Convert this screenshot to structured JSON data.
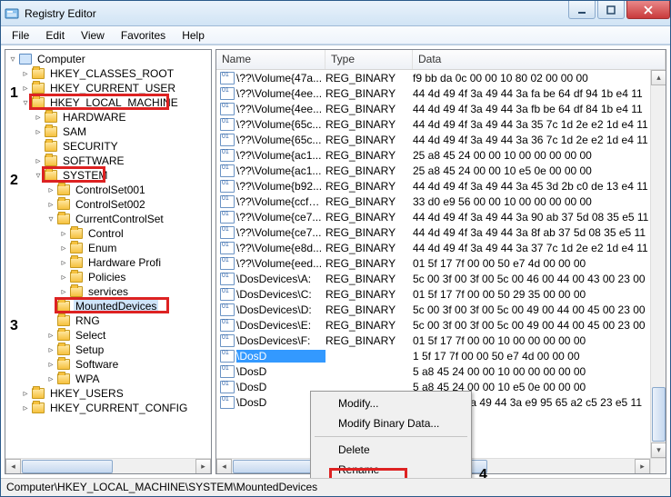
{
  "window": {
    "title": "Registry Editor"
  },
  "menu": {
    "file": "File",
    "edit": "Edit",
    "view": "View",
    "favorites": "Favorites",
    "help": "Help"
  },
  "tree": [
    {
      "lvl": 0,
      "toggle": "▿",
      "icon": "computer",
      "label": "Computer"
    },
    {
      "lvl": 1,
      "toggle": "▹",
      "icon": "folder",
      "label": "HKEY_CLASSES_ROOT"
    },
    {
      "lvl": 1,
      "toggle": "▹",
      "icon": "folder",
      "label": "HKEY_CURRENT_USER"
    },
    {
      "lvl": 1,
      "toggle": "▿",
      "icon": "folder",
      "label": "HKEY_LOCAL_MACHINE",
      "red": true
    },
    {
      "lvl": 2,
      "toggle": "▹",
      "icon": "folder",
      "label": "HARDWARE"
    },
    {
      "lvl": 2,
      "toggle": "▹",
      "icon": "folder",
      "label": "SAM"
    },
    {
      "lvl": 2,
      "toggle": "",
      "icon": "folder",
      "label": "SECURITY"
    },
    {
      "lvl": 2,
      "toggle": "▹",
      "icon": "folder",
      "label": "SOFTWARE"
    },
    {
      "lvl": 2,
      "toggle": "▿",
      "icon": "folder",
      "label": "SYSTEM",
      "red": true
    },
    {
      "lvl": 3,
      "toggle": "▹",
      "icon": "folder",
      "label": "ControlSet001"
    },
    {
      "lvl": 3,
      "toggle": "▹",
      "icon": "folder",
      "label": "ControlSet002"
    },
    {
      "lvl": 3,
      "toggle": "▿",
      "icon": "folder",
      "label": "CurrentControlSet"
    },
    {
      "lvl": 4,
      "toggle": "▹",
      "icon": "folder",
      "label": "Control"
    },
    {
      "lvl": 4,
      "toggle": "▹",
      "icon": "folder",
      "label": "Enum"
    },
    {
      "lvl": 4,
      "toggle": "▹",
      "icon": "folder",
      "label": "Hardware Profi"
    },
    {
      "lvl": 4,
      "toggle": "▹",
      "icon": "folder",
      "label": "Policies"
    },
    {
      "lvl": 4,
      "toggle": "▹",
      "icon": "folder",
      "label": "services"
    },
    {
      "lvl": 3,
      "toggle": "",
      "icon": "folder",
      "label": "MountedDevices",
      "red": true,
      "sel": true
    },
    {
      "lvl": 3,
      "toggle": "",
      "icon": "folder",
      "label": "RNG"
    },
    {
      "lvl": 3,
      "toggle": "▹",
      "icon": "folder",
      "label": "Select"
    },
    {
      "lvl": 3,
      "toggle": "▹",
      "icon": "folder",
      "label": "Setup"
    },
    {
      "lvl": 3,
      "toggle": "▹",
      "icon": "folder",
      "label": "Software"
    },
    {
      "lvl": 3,
      "toggle": "▹",
      "icon": "folder",
      "label": "WPA"
    },
    {
      "lvl": 1,
      "toggle": "▹",
      "icon": "folder",
      "label": "HKEY_USERS"
    },
    {
      "lvl": 1,
      "toggle": "▹",
      "icon": "folder",
      "label": "HKEY_CURRENT_CONFIG"
    }
  ],
  "list": {
    "cols": {
      "name": "Name",
      "type": "Type",
      "data": "Data"
    },
    "rows": [
      {
        "name": "\\??\\Volume{47a...",
        "type": "REG_BINARY",
        "data": "f9 bb da 0c 00 00 10 80 02 00 00 00"
      },
      {
        "name": "\\??\\Volume{4ee...",
        "type": "REG_BINARY",
        "data": "44 4d 49 4f 3a 49 44 3a fa be 64 df 94 1b e4 11"
      },
      {
        "name": "\\??\\Volume{4ee...",
        "type": "REG_BINARY",
        "data": "44 4d 49 4f 3a 49 44 3a fb be 64 df 84 1b e4 11"
      },
      {
        "name": "\\??\\Volume{65c...",
        "type": "REG_BINARY",
        "data": "44 4d 49 4f 3a 49 44 3a 35 7c 1d 2e e2 1d e4 11"
      },
      {
        "name": "\\??\\Volume{65c...",
        "type": "REG_BINARY",
        "data": "44 4d 49 4f 3a 49 44 3a 36 7c 1d 2e e2 1d e4 11"
      },
      {
        "name": "\\??\\Volume{ac1...",
        "type": "REG_BINARY",
        "data": "25 a8 45 24 00 00 10 00 00 00 00 00"
      },
      {
        "name": "\\??\\Volume{ac1...",
        "type": "REG_BINARY",
        "data": "25 a8 45 24 00 00 10 e5 0e 00 00 00"
      },
      {
        "name": "\\??\\Volume{b92...",
        "type": "REG_BINARY",
        "data": "44 4d 49 4f 3a 49 44 3a 45 3d 2b c0 de 13 e4 11"
      },
      {
        "name": "\\??\\Volume{ccf1...",
        "type": "REG_BINARY",
        "data": "33 d0 e9 56 00 00 10 00 00 00 00 00"
      },
      {
        "name": "\\??\\Volume{ce7...",
        "type": "REG_BINARY",
        "data": "44 4d 49 4f 3a 49 44 3a 90 ab 37 5d 08 35 e5 11"
      },
      {
        "name": "\\??\\Volume{ce7...",
        "type": "REG_BINARY",
        "data": "44 4d 49 4f 3a 49 44 3a 8f ab 37 5d 08 35 e5 11"
      },
      {
        "name": "\\??\\Volume{e8d...",
        "type": "REG_BINARY",
        "data": "44 4d 49 4f 3a 49 44 3a 37 7c 1d 2e e2 1d e4 11"
      },
      {
        "name": "\\??\\Volume{eed...",
        "type": "REG_BINARY",
        "data": "01 5f 17 7f 00 00 50 e7 4d 00 00 00"
      },
      {
        "name": "\\DosDevices\\A:",
        "type": "REG_BINARY",
        "data": "5c 00 3f 00 3f 00 5c 00 46 00 44 00 43 00 23 00"
      },
      {
        "name": "\\DosDevices\\C:",
        "type": "REG_BINARY",
        "data": "01 5f 17 7f 00 00 50 29 35 00 00 00"
      },
      {
        "name": "\\DosDevices\\D:",
        "type": "REG_BINARY",
        "data": "5c 00 3f 00 3f 00 5c 00 49 00 44 00 45 00 23 00"
      },
      {
        "name": "\\DosDevices\\E:",
        "type": "REG_BINARY",
        "data": "5c 00 3f 00 3f 00 5c 00 49 00 44 00 45 00 23 00"
      },
      {
        "name": "\\DosDevices\\F:",
        "type": "REG_BINARY",
        "data": "01 5f 17 7f 00 00 10 00 00 00 00 00"
      },
      {
        "name": "\\DosD",
        "type": "",
        "data": "1 5f 17 7f 00 00 50 e7 4d 00 00 00",
        "sel": true
      },
      {
        "name": "\\DosD",
        "type": "",
        "data": "5 a8 45 24 00 00 10 00 00 00 00 00"
      },
      {
        "name": "\\DosD",
        "type": "",
        "data": "5 a8 45 24 00 00 10 e5 0e 00 00 00"
      },
      {
        "name": "\\DosD",
        "type": "",
        "data": "4 4d 49 4f 3a 49 44 3a e9 95 65 a2 c5 23 e5 11"
      }
    ]
  },
  "context_menu": {
    "modify": "Modify...",
    "modify_binary": "Modify Binary Data...",
    "delete": "Delete",
    "rename": "Rename"
  },
  "annotations": {
    "n1": "1",
    "n2": "2",
    "n3": "3",
    "n4": "4"
  },
  "statusbar": "Computer\\HKEY_LOCAL_MACHINE\\SYSTEM\\MountedDevices"
}
